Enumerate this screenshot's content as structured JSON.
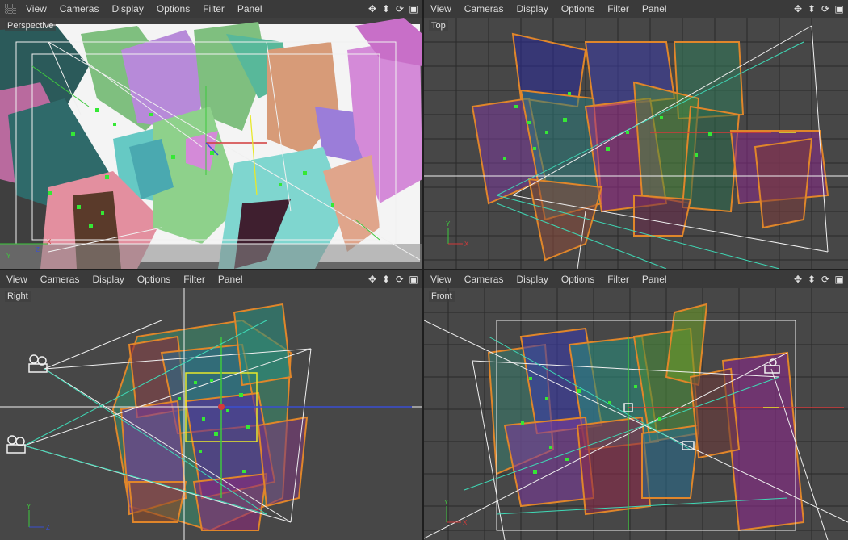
{
  "menu": [
    "View",
    "Cameras",
    "Display",
    "Options",
    "Filter",
    "Panel"
  ],
  "tool_icons": [
    "move-view-icon",
    "dolly-view-icon",
    "rotate-view-icon",
    "maximize-panel-icon"
  ],
  "tool_glyphs": [
    "✥",
    "⬍",
    "⟳",
    "▣"
  ],
  "viewports": {
    "perspective": {
      "label": "Perspective"
    },
    "top": {
      "label": "Top"
    },
    "right": {
      "label": "Right"
    },
    "front": {
      "label": "Front"
    }
  },
  "axes": {
    "perspective": {
      "a": "X",
      "b": "Z",
      "c": "Y"
    },
    "top": {
      "a": "Y",
      "b": "X"
    },
    "right": {
      "a": "Y",
      "b": "Z"
    },
    "front": {
      "a": "Y",
      "b": "X"
    }
  },
  "colors": {
    "viewport_bg": "#474747",
    "grid": "#2a2a2a",
    "selection_orange": "#e0862a",
    "axis_x": "#d23a3a",
    "axis_y": "#3ec93e",
    "axis_z": "#3a4fd2",
    "point_green": "#35e835",
    "guide_white": "#f0f0f0",
    "guide_cyan": "#3fd9b6"
  }
}
